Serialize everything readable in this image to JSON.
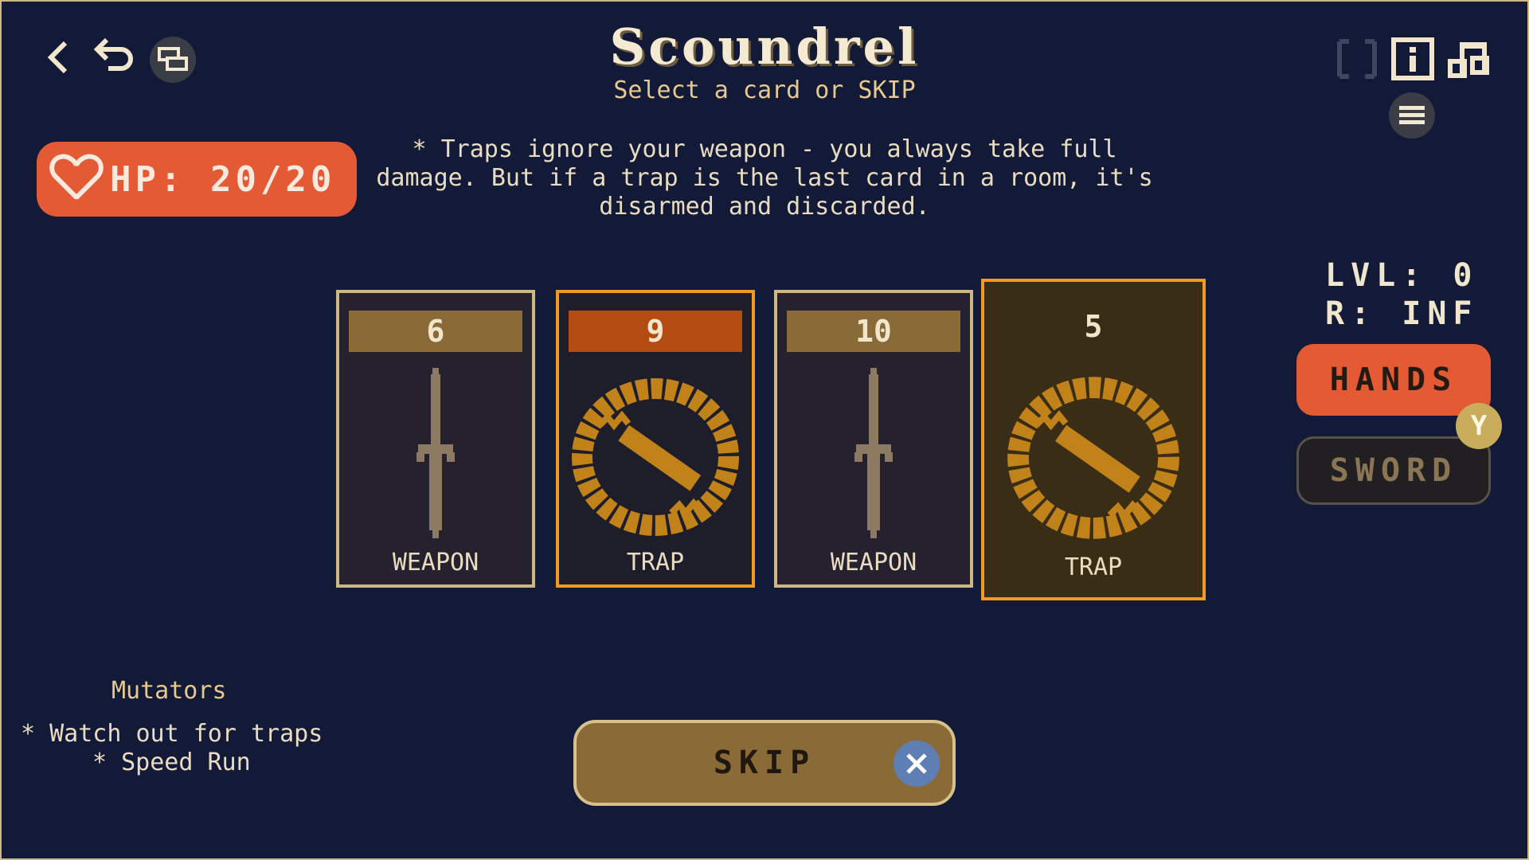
{
  "header": {
    "title": "Scoundrel",
    "subtitle": "Select a card or SKIP"
  },
  "nav": {
    "back_icon": "chevron-left-icon",
    "undo_icon": "undo-icon",
    "windows_icon": "window-toggle-icon"
  },
  "top_right": {
    "icons": [
      "fullscreen-icon",
      "info-icon",
      "music-icon",
      "menu-icon"
    ]
  },
  "player": {
    "hp_label": "HP: 20/20",
    "hp_icon": "heart-icon"
  },
  "hint": "* Traps ignore your weapon - you always take full damage. But if a trap is the last card in a room, it's disarmed and discarded.",
  "cards": [
    {
      "value": "6",
      "label": "WEAPON",
      "kind": "weapon",
      "icon": "sword-icon"
    },
    {
      "value": "9",
      "label": "TRAP",
      "kind": "trap",
      "icon": "trap-icon"
    },
    {
      "value": "10",
      "label": "WEAPON",
      "kind": "weapon",
      "icon": "sword-icon"
    },
    {
      "value": "5",
      "label": "TRAP",
      "kind": "trap",
      "icon": "trap-icon"
    }
  ],
  "stats": {
    "level": "LVL: 0",
    "rooms": "R: INF"
  },
  "combat": {
    "hands_label": "HANDS",
    "sword_label": "SWORD",
    "toggle_key": "Y"
  },
  "mutators": {
    "title": "Mutators",
    "items": [
      "* Watch out for traps",
      "* Speed Run"
    ]
  },
  "skip": {
    "label": "SKIP",
    "button_icon": "x-button-icon"
  },
  "colors": {
    "background": "#121a38",
    "accent_red": "#e35a34",
    "card_gold": "#c2821a",
    "weapon_header": "#8a6a37",
    "trap_header": "#b44b12",
    "border": "#cdb784"
  }
}
